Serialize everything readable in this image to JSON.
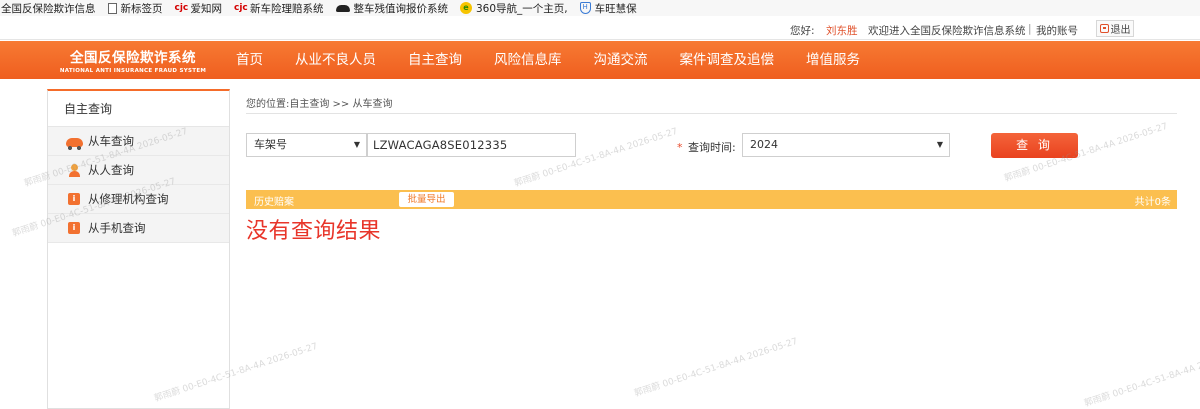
{
  "bookmarks": [
    {
      "icon": "none",
      "label": "全国反保险欺诈信息"
    },
    {
      "icon": "page-icon",
      "label": "新标签页"
    },
    {
      "icon": "cjc-logo-icon",
      "label": "爱知网"
    },
    {
      "icon": "cjc-logo-icon",
      "label": "新车险理赔系统"
    },
    {
      "icon": "car-icon",
      "label": "整车残值询报价系统"
    },
    {
      "icon": "browser-360-icon",
      "label": "360导航_一个主页,"
    },
    {
      "icon": "shield-icon",
      "label": "车旺慧保"
    }
  ],
  "userbar": {
    "greeting": "您好:",
    "username": "刘东胜",
    "welcome": "欢迎进入全国反保险欺诈信息系统",
    "separator": "|",
    "account": "我的账号",
    "logout": "退出"
  },
  "brand": {
    "title": "全国反保险欺诈系统",
    "subtitle": "NATIONAL ANTI INSURANCE FRAUD SYSTEM"
  },
  "nav": [
    "首页",
    "从业不良人员",
    "自主查询",
    "风险信息库",
    "沟通交流",
    "案件调查及追偿",
    "增值服务"
  ],
  "sidebar": {
    "title": "自主查询",
    "items": [
      {
        "label": "从车查询",
        "icon": "car-icon"
      },
      {
        "label": "从人查询",
        "icon": "person-icon"
      },
      {
        "label": "从修理机构查询",
        "icon": "repair-shop-icon"
      },
      {
        "label": "从手机查询",
        "icon": "phone-icon"
      }
    ]
  },
  "main": {
    "breadcrumb": "您的位置:自主查询 >> 从车查询",
    "query_type": "车架号",
    "vin_value": "LZWACAGA8SE012335",
    "time_required_mark": "*",
    "time_label": "查询时间:",
    "year_value": "2024",
    "query_button": "查 询",
    "results_label": "历史赔案",
    "export_button": "批量导出",
    "total_count": "共计0条",
    "no_result": "没有查询结果"
  },
  "watermark": "郭雨蔚 00-E0-4C-51-8A-4A 2026-05-27",
  "colors": {
    "nav_bg": "#f56c2a",
    "results_bar": "#fbbf4f",
    "query_button": "#f1512c",
    "no_result_text": "#e8352a"
  }
}
